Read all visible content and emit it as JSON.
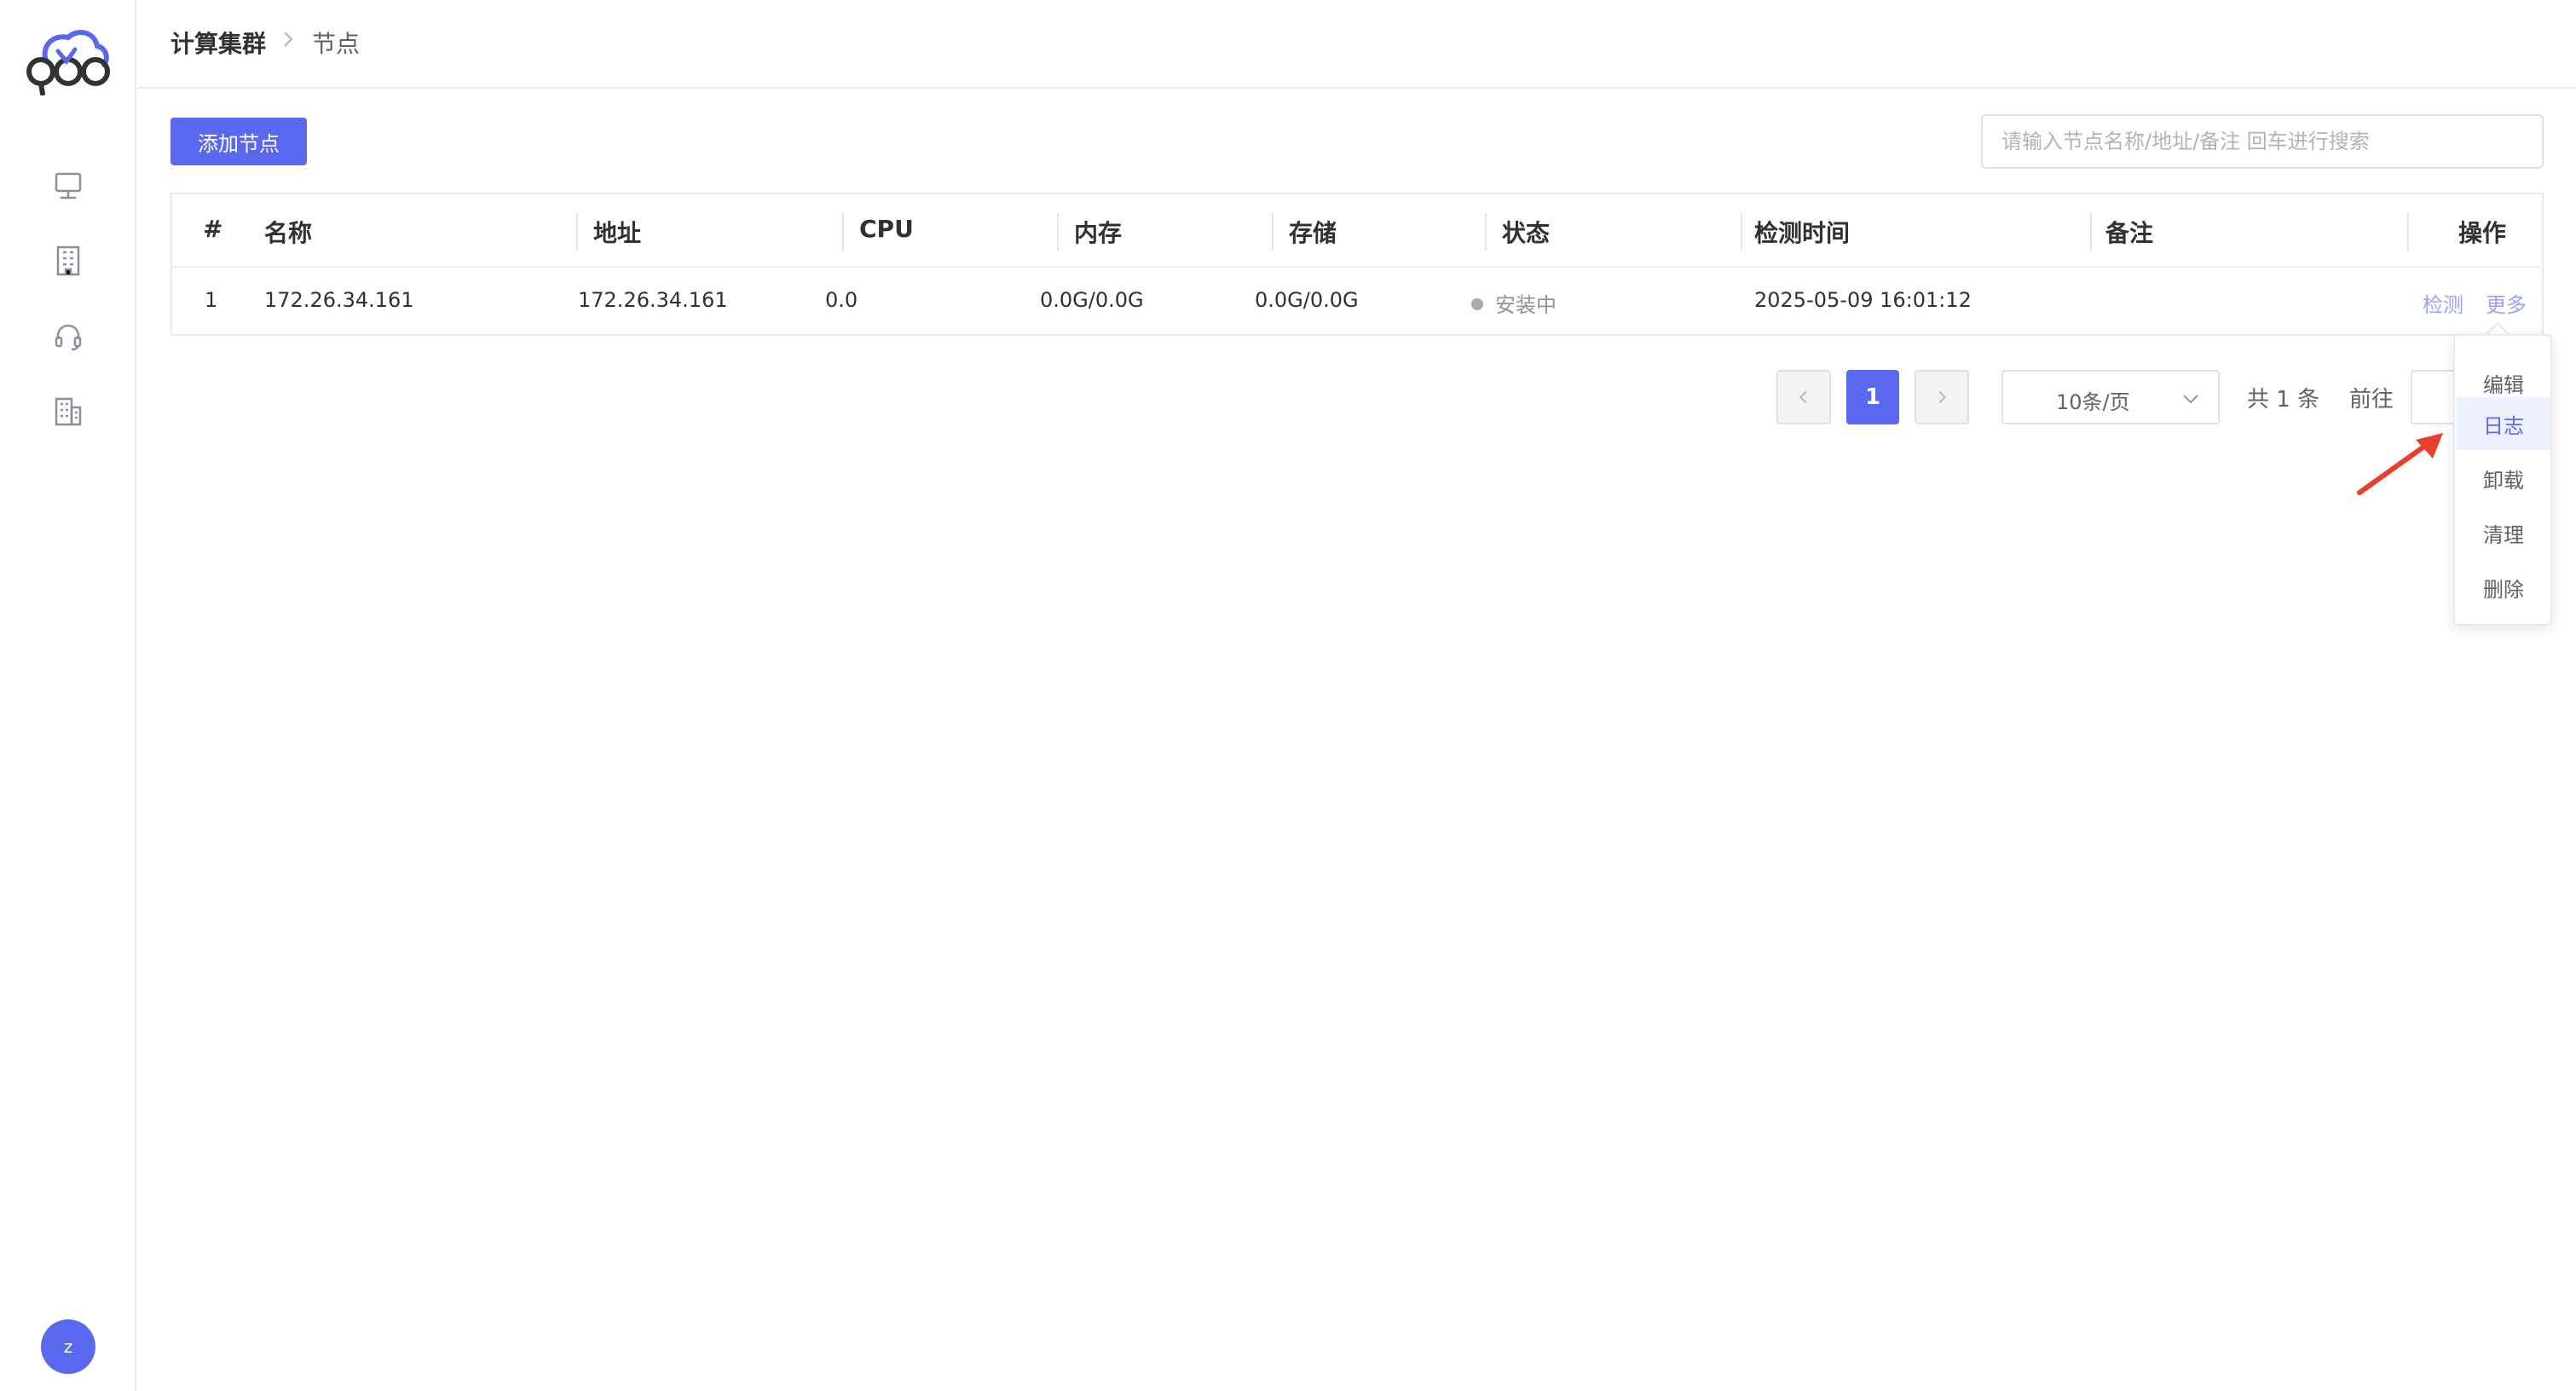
{
  "colors": {
    "primary": "#5a68f0",
    "link_muted": "#99a3f7",
    "annotation_arrow": "#e8402a",
    "status_gray": "#a8abb2"
  },
  "sidebar": {
    "logo_icon": "cloud-logo-icon",
    "items": [
      {
        "icon": "monitor-icon"
      },
      {
        "icon": "building-icon"
      },
      {
        "icon": "headset-icon"
      },
      {
        "icon": "office-building-icon"
      }
    ],
    "avatar_letter": "z"
  },
  "breadcrumb": {
    "parent": "计算集群",
    "current": "节点"
  },
  "toolbar": {
    "add_label": "添加节点",
    "search_placeholder": "请输入节点名称/地址/备注 回车进行搜索",
    "search_value": ""
  },
  "table": {
    "columns": [
      "#",
      "名称",
      "地址",
      "CPU",
      "内存",
      "存储",
      "状态",
      "检测时间",
      "备注",
      "操作"
    ],
    "rows": [
      {
        "index": "1",
        "name": "172.26.34.161",
        "address": "172.26.34.161",
        "cpu": "0.0",
        "memory": "0.0G/0.0G",
        "storage": "0.0G/0.0G",
        "status": "安装中",
        "checked_at": "2025-05-09 16:01:12",
        "remark": "",
        "action_check": "检测",
        "action_more": "更多"
      }
    ]
  },
  "pagination": {
    "current_page": "1",
    "page_size": "10条/页",
    "total": "共 1 条",
    "goto_label": "前往",
    "goto_value": ""
  },
  "more_menu": {
    "items": [
      "编辑",
      "日志",
      "卸载",
      "清理",
      "删除"
    ],
    "highlighted": "日志"
  }
}
